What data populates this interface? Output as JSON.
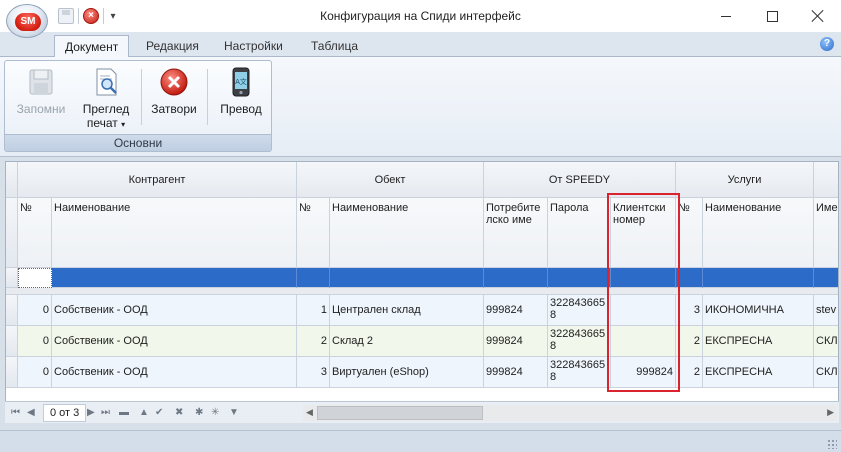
{
  "window": {
    "title": "Конфигурация на Спиди интерфейс",
    "app_badge": "SM"
  },
  "ribbon": {
    "tabs": [
      {
        "label": "Документ",
        "active": true
      },
      {
        "label": "Редакция",
        "active": false
      },
      {
        "label": "Настройки",
        "active": false
      },
      {
        "label": "Таблица",
        "active": false
      }
    ],
    "group_label": "Основни",
    "buttons": {
      "save": "Запомни",
      "preview_line1": "Преглед",
      "preview_line2": "печат",
      "close": "Затвори",
      "translation": "Превод"
    }
  },
  "grid": {
    "bands": {
      "contractor": "Контрагент",
      "object": "Обект",
      "from_speedy": "От SPEEDY",
      "services": "Услуги"
    },
    "columns": {
      "c_no": "№",
      "c_name": "Наименование",
      "o_no": "№",
      "o_name": "Наименование",
      "user_line1": "Потребите",
      "user_line2": "лско име",
      "password": "Парола",
      "client_line1": "Клиентски",
      "client_line2": "номер",
      "s_no": "№",
      "s_name": "Наименование",
      "more": "Име"
    },
    "rows": [
      {
        "c_no": "0",
        "c_name": "Собственик - ООД",
        "o_no": "1",
        "o_name": "Централен склад",
        "user": "999824",
        "pass1": "322843665",
        "pass2": "8",
        "client": "",
        "s_no": "3",
        "s_name": "ИКОНОМИЧНА",
        "more": "stev"
      },
      {
        "c_no": "0",
        "c_name": "Собственик - ООД",
        "o_no": "2",
        "o_name": "Склад 2",
        "user": "999824",
        "pass1": "322843665",
        "pass2": "8",
        "client": "",
        "s_no": "2",
        "s_name": "ЕКСПРЕСНА",
        "more": "СКЛ"
      },
      {
        "c_no": "0",
        "c_name": "Собственик - ООД",
        "o_no": "3",
        "o_name": "Виртуален (eShop)",
        "user": "999824",
        "pass1": "322843665",
        "pass2": "8",
        "client": "999824",
        "s_no": "2",
        "s_name": "ЕКСПРЕСНА",
        "more": "СКЛ"
      }
    ]
  },
  "navigator": {
    "page_text": "0 от 3"
  },
  "colors": {
    "highlight": "#d9232e",
    "filter_row": "#2d6bc8",
    "accent": "#2c6ac4"
  }
}
